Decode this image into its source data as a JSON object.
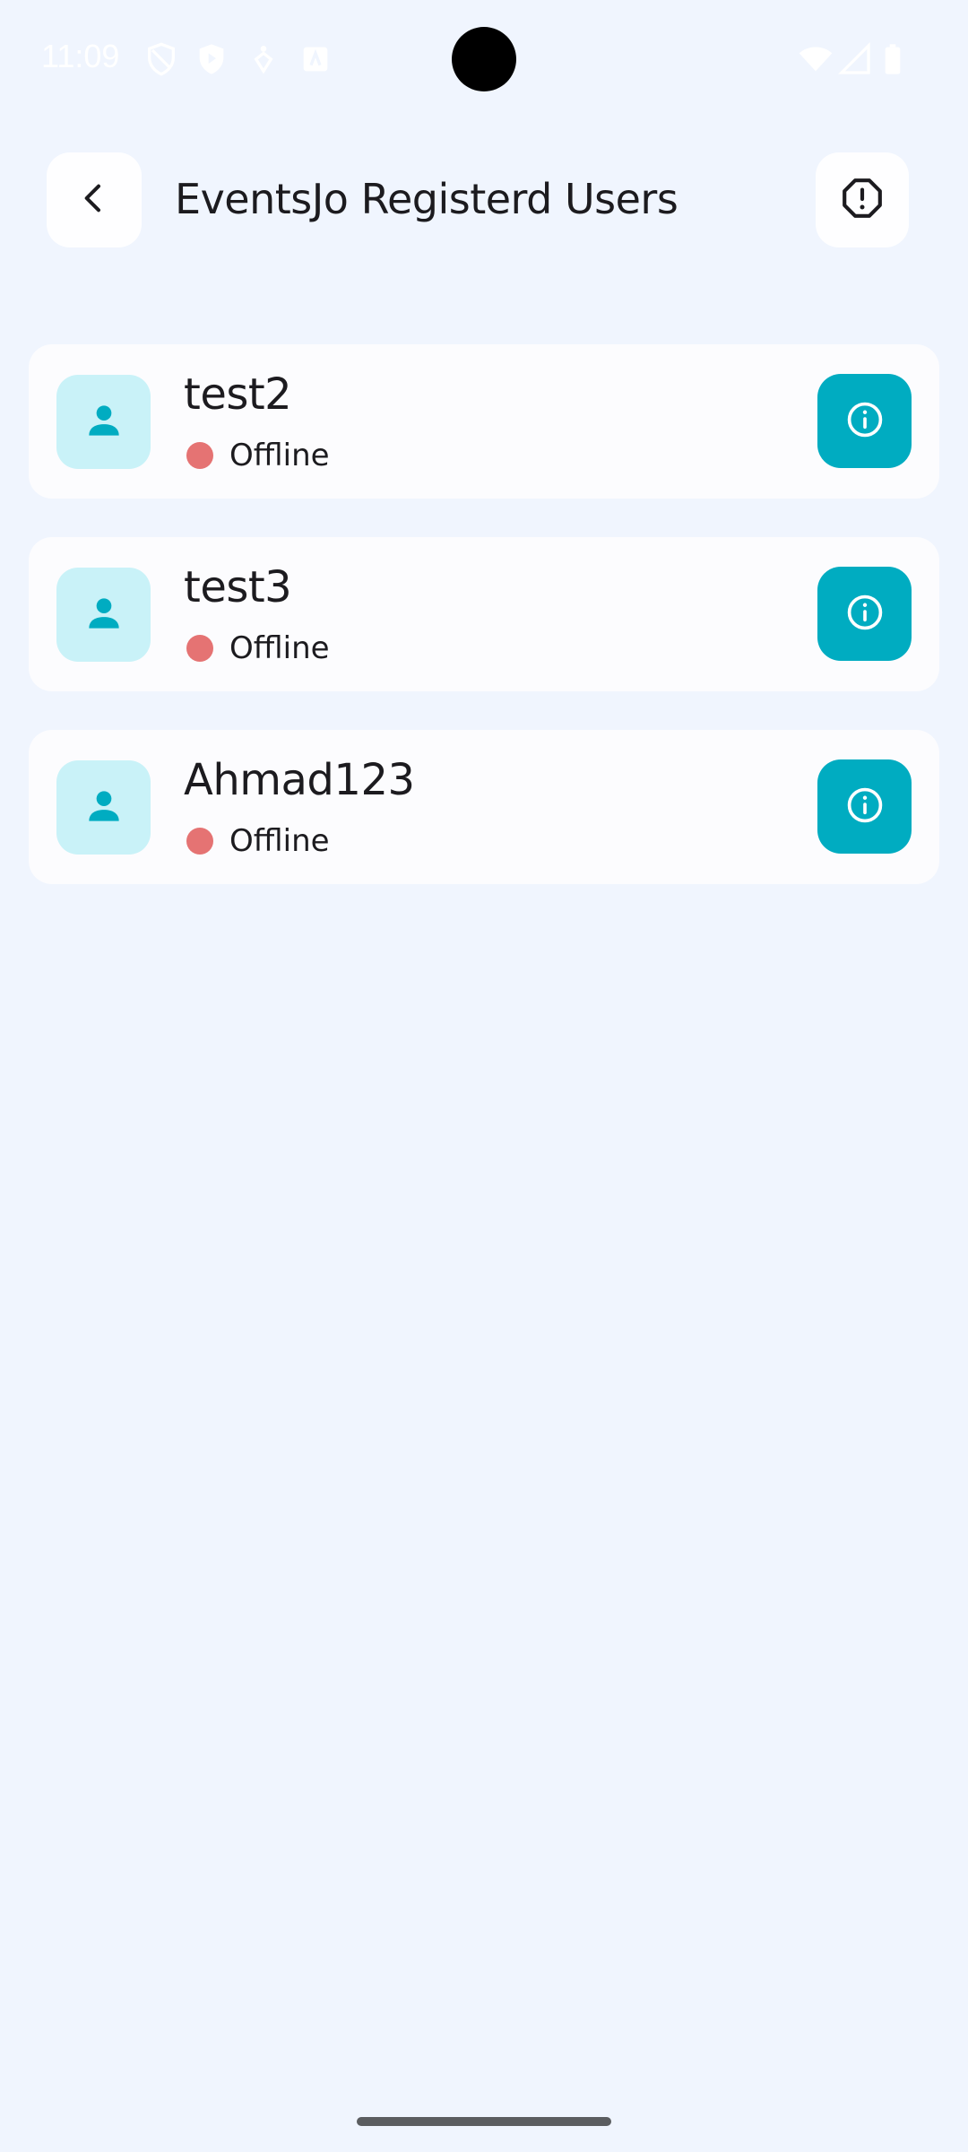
{
  "status_bar": {
    "time": "11:09",
    "icons": [
      "vpn-shield-icon",
      "play-protect-icon",
      "accessibility-icon",
      "app-store-icon",
      "wifi-icon",
      "signal-icon",
      "battery-icon"
    ]
  },
  "header": {
    "title": "EventsJo Registerd Users",
    "back_icon": "chevron-left-icon",
    "report_icon": "alert-octagon-icon"
  },
  "users": [
    {
      "name": "test2",
      "status": "Offline"
    },
    {
      "name": "test3",
      "status": "Offline"
    },
    {
      "name": "Ahmad123",
      "status": "Offline"
    }
  ],
  "colors": {
    "background": "#f0f5fe",
    "card": "#fcfcfe",
    "accent": "#00acc1",
    "avatar_bg": "#c9f2f8",
    "offline": "#e57373"
  }
}
